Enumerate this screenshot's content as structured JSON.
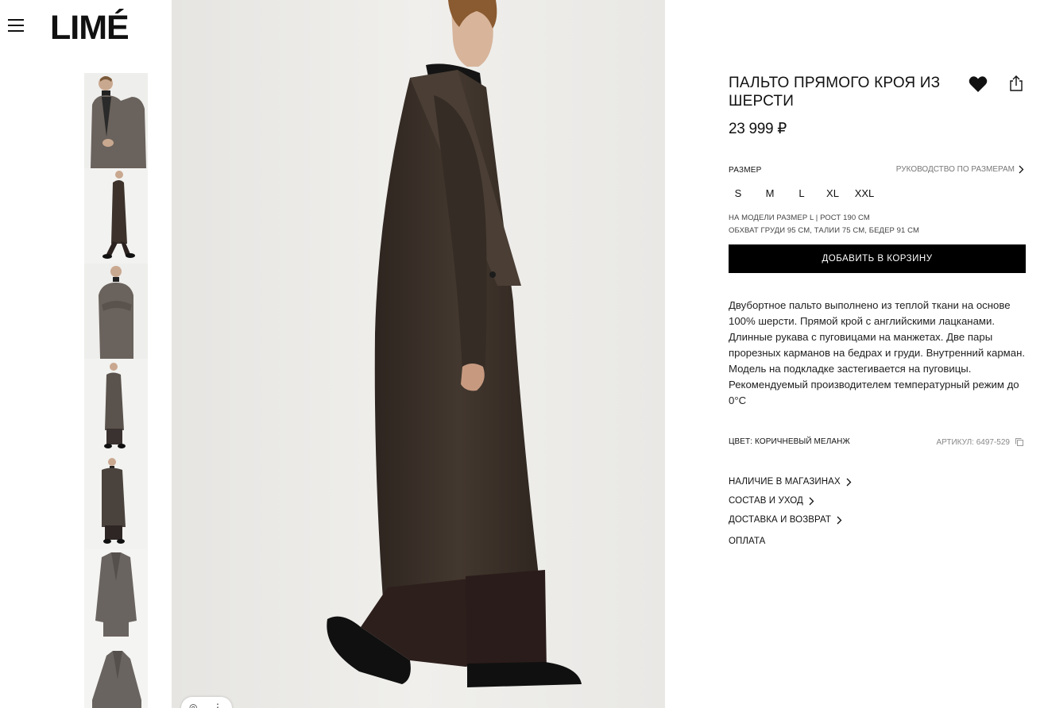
{
  "header": {
    "logo": "LIMÉ"
  },
  "product": {
    "title": "ПАЛЬТО ПРЯМОГО КРОЯ ИЗ ШЕРСТИ",
    "price": "23 999 ₽",
    "size_label": "РАЗМЕР",
    "size_guide": "РУКОВОДСТВО ПО РАЗМЕРАМ",
    "sizes": [
      "S",
      "M",
      "L",
      "XL",
      "XXL"
    ],
    "model_info_1": "НА МОДЕЛИ РАЗМЕР L | РОСТ 190 СМ",
    "model_info_2": "ОБХВАТ ГРУДИ 95 СМ, ТАЛИИ 75 СМ, БЕДЕР 91 СМ",
    "add_to_cart": "ДОБАВИТЬ В КОРЗИНУ",
    "description": "Двубортное пальто выполнено из теплой ткани на основе 100% шерсти. Прямой крой с английскими лацканами. Длинные рукава с пуговицами на манжетах. Две пары прорезных карманов на бедрах и груди. Внутренний карман. Модель на подкладке застегивается на пуговицы. Рекомендуемый производителем температурный режим до 0°С",
    "color": "ЦВЕТ: КОРИЧНЕВЫЙ МЕЛАНЖ",
    "sku": "АРТИКУЛ: 6497-529",
    "links": [
      {
        "label": "НАЛИЧИЕ В МАГАЗИНАХ"
      },
      {
        "label": "СОСТАВ И УХОД"
      },
      {
        "label": "ДОСТАВКА И ВОЗВРАТ"
      }
    ],
    "payment": "ОПЛАТА"
  },
  "colors": {
    "coat": "#3d332c",
    "background": "#ecebe8",
    "button": "#000000"
  },
  "icons": {
    "menu": "hamburger-icon",
    "favorite": "heart-icon",
    "share": "share-icon",
    "copy": "copy-icon",
    "chevron": "chevron-right-icon"
  }
}
